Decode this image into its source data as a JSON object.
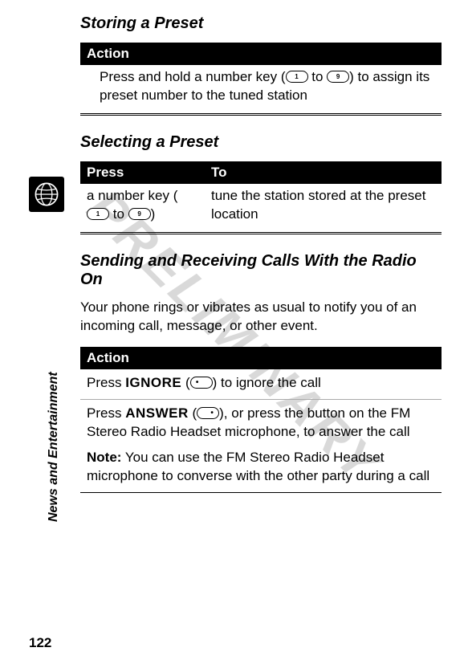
{
  "watermark": "PRELIMINARY",
  "sidebar": {
    "category_label": "News and Entertainment"
  },
  "sections": {
    "storing": {
      "title": "Storing a Preset",
      "action_header": "Action",
      "action_text_1": "Press and hold a number key (",
      "action_text_2": " to ",
      "action_text_3": ") to assign its preset number to the tuned station",
      "key1_label": "1",
      "key9_label": "9"
    },
    "selecting": {
      "title": "Selecting a Preset",
      "col_press": "Press",
      "col_to": "To",
      "press_text_1": "a number key (",
      "press_text_2": " to ",
      "press_text_3": ")",
      "key1_label": "1",
      "key9_label": "9",
      "to_text": "tune the station stored at the preset location"
    },
    "radio_calls": {
      "title": "Sending and Receiving Calls With the Radio On",
      "intro": "Your phone rings or vibrates as usual to notify you of an incoming call, message, or other event.",
      "action_header": "Action",
      "row1_pre": "Press ",
      "row1_label": "IGNORE",
      "row1_mid": " (",
      "row1_post": ") to ignore the call",
      "row2_pre": "Press ",
      "row2_label": "ANSWER",
      "row2_mid": " (",
      "row2_post": "), or press the button on the FM Stereo Radio Headset microphone, to answer the call",
      "note_label": "Note:",
      "note_text": " You can use the FM Stereo Radio Headset microphone to converse with the other party during a call"
    }
  },
  "page_number": "122"
}
